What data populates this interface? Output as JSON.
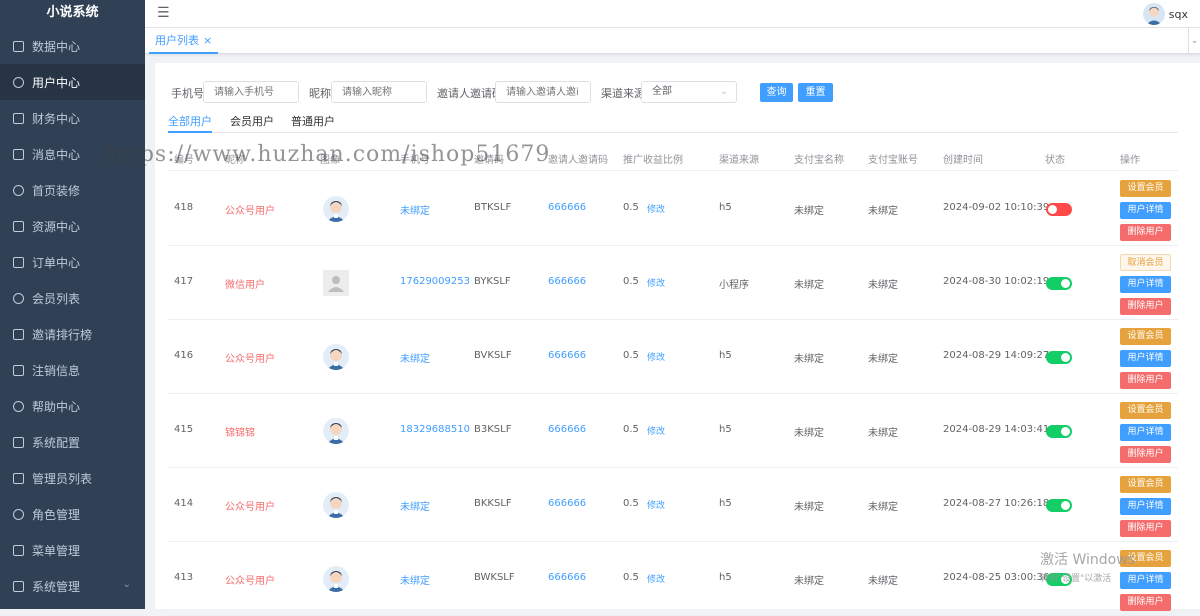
{
  "app": {
    "title": "小说系统"
  },
  "sidebar": {
    "items": [
      {
        "label": "数据中心",
        "icon": "dashboard-icon"
      },
      {
        "label": "用户中心",
        "icon": "user-icon"
      },
      {
        "label": "财务中心",
        "icon": "wallet-icon"
      },
      {
        "label": "消息中心",
        "icon": "message-icon"
      },
      {
        "label": "首页装修",
        "icon": "box-icon"
      },
      {
        "label": "资源中心",
        "icon": "resource-icon"
      },
      {
        "label": "订单中心",
        "icon": "order-icon"
      },
      {
        "label": "会员列表",
        "icon": "member-icon"
      },
      {
        "label": "邀请排行榜",
        "icon": "bar-chart-icon"
      },
      {
        "label": "注销信息",
        "icon": "logout-icon"
      },
      {
        "label": "帮助中心",
        "icon": "help-icon"
      },
      {
        "label": "系统配置",
        "icon": "list-icon"
      },
      {
        "label": "管理员列表",
        "icon": "admin-icon"
      },
      {
        "label": "角色管理",
        "icon": "role-icon"
      },
      {
        "label": "菜单管理",
        "icon": "menu-icon"
      },
      {
        "label": "系统管理",
        "icon": "settings-icon"
      }
    ],
    "active_index": 1
  },
  "header": {
    "username": "sqx"
  },
  "tabs": [
    {
      "label": "用户列表",
      "close": "×"
    }
  ],
  "filters": {
    "phone_label": "手机号:",
    "phone_placeholder": "请输入手机号",
    "nickname_label": "昵称:",
    "nickname_placeholder": "请输入昵称",
    "invite_label": "邀请人邀请码:",
    "invite_placeholder": "请输入邀请人邀i",
    "channel_label": "渠道来源:",
    "channel_value": "全部",
    "query_button": "查询",
    "reset_button": "重置"
  },
  "subtabs": [
    "全部用户",
    "会员用户",
    "普通用户"
  ],
  "table": {
    "headers": [
      "编号",
      "昵称",
      "图像",
      "手机号",
      "邀请码",
      "邀请人邀请码",
      "推广收益比例",
      "渠道来源",
      "支付宝名称",
      "支付宝账号",
      "创建时间",
      "状态",
      "操作"
    ],
    "edit_label": "修改",
    "rows": [
      {
        "id": "418",
        "nickname": "公众号用户",
        "phone": "未绑定",
        "invite_code": "BTKSLF",
        "inviter_code": "666666",
        "ratio": "0.5",
        "channel": "h5",
        "alipay_name": "未绑定",
        "alipay_account": "未绑定",
        "created": "2024-09-02 10:10:39",
        "status_on": false,
        "ops": [
          "设置会员",
          "用户详情",
          "删除用户"
        ],
        "avatar_placeholder": false
      },
      {
        "id": "417",
        "nickname": "微信用户",
        "phone": "17629009253",
        "invite_code": "BYKSLF",
        "inviter_code": "666666",
        "ratio": "0.5",
        "channel": "小程序",
        "alipay_name": "未绑定",
        "alipay_account": "未绑定",
        "created": "2024-08-30 10:02:19",
        "status_on": true,
        "ops": [
          "取消会员",
          "用户详情",
          "删除用户"
        ],
        "avatar_placeholder": true
      },
      {
        "id": "416",
        "nickname": "公众号用户",
        "phone": "未绑定",
        "invite_code": "BVKSLF",
        "inviter_code": "666666",
        "ratio": "0.5",
        "channel": "h5",
        "alipay_name": "未绑定",
        "alipay_account": "未绑定",
        "created": "2024-08-29 14:09:27",
        "status_on": true,
        "ops": [
          "设置会员",
          "用户详情",
          "删除用户"
        ],
        "avatar_placeholder": false
      },
      {
        "id": "415",
        "nickname": "锦锦锦",
        "phone": "18329688510",
        "invite_code": "B3KSLF",
        "inviter_code": "666666",
        "ratio": "0.5",
        "channel": "h5",
        "alipay_name": "未绑定",
        "alipay_account": "未绑定",
        "created": "2024-08-29 14:03:41",
        "status_on": true,
        "ops": [
          "设置会员",
          "用户详情",
          "删除用户"
        ],
        "avatar_placeholder": false
      },
      {
        "id": "414",
        "nickname": "公众号用户",
        "phone": "未绑定",
        "invite_code": "BKKSLF",
        "inviter_code": "666666",
        "ratio": "0.5",
        "channel": "h5",
        "alipay_name": "未绑定",
        "alipay_account": "未绑定",
        "created": "2024-08-27 10:26:18",
        "status_on": true,
        "ops": [
          "设置会员",
          "用户详情",
          "删除用户"
        ],
        "avatar_placeholder": false
      },
      {
        "id": "413",
        "nickname": "公众号用户",
        "phone": "未绑定",
        "invite_code": "BWKSLF",
        "inviter_code": "666666",
        "ratio": "0.5",
        "channel": "h5",
        "alipay_name": "未绑定",
        "alipay_account": "未绑定",
        "created": "2024-08-25 03:00:36",
        "status_on": true,
        "ops": [
          "设置会员",
          "用户详情",
          "删除用户"
        ],
        "avatar_placeholder": false
      }
    ]
  },
  "watermark": "https://www.huzhan.com/ishop51679",
  "os_overlay": {
    "line1": "激活 Windows",
    "line2": "转到\"设置\"以激活"
  }
}
